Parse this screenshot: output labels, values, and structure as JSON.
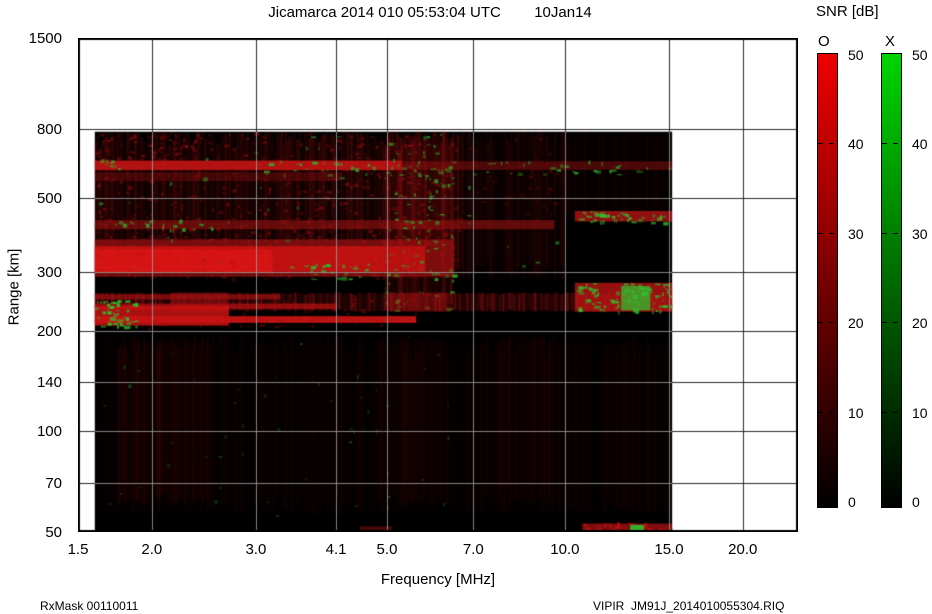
{
  "header": {
    "title": "Jicamarca 2014 010 05:53:04 UTC        10Jan14"
  },
  "footer": {
    "rx_mask": "RxMask 00110011",
    "file_info": "VIPIR  JM91J_2014010055304.RIQ"
  },
  "colorbar": {
    "title": "SNR [dB]",
    "min": 0,
    "max": 50,
    "bars": [
      {
        "label": "O",
        "top_color": "#ee0000",
        "bottom_color": "#000000",
        "ticks": [
          50,
          40,
          30,
          20,
          10,
          0
        ]
      },
      {
        "label": "X",
        "top_color": "#00d400",
        "bottom_color": "#000000",
        "ticks": [
          50,
          40,
          30,
          20,
          10,
          0
        ]
      }
    ]
  },
  "chart_data": {
    "type": "heatmap",
    "title": "Jicamarca 2014 010 05:53:04 UTC 10Jan14",
    "xlabel": "Frequency [MHz]",
    "ylabel": "Range [km]",
    "x_scale": "log",
    "y_scale": "log",
    "xlim": [
      1.5,
      24.8
    ],
    "ylim": [
      50,
      1500
    ],
    "x_ticks": [
      1.5,
      2.0,
      3.0,
      4.1,
      5.0,
      7.0,
      10.0,
      15.0,
      20.0
    ],
    "x_tick_labels": [
      "1.5",
      "2.0",
      "3.0",
      "4.1",
      "5.0",
      "7.0",
      "10.0",
      "15.0",
      "20.0"
    ],
    "y_ticks": [
      50,
      70,
      100,
      140,
      200,
      300,
      500,
      800,
      1500
    ],
    "y_tick_labels": [
      "50",
      "70",
      "100",
      "140",
      "200",
      "300",
      "500",
      "800",
      "1500"
    ],
    "grid": true,
    "snr_range": [
      0,
      50
    ],
    "data_extent": {
      "f": [
        1.6,
        15.2
      ],
      "r": [
        50,
        788
      ]
    },
    "background_color": "#000000",
    "grid_color_over_data": "#9a9a9a",
    "grid_color_outside": "#2a2a2a",
    "features": [
      {
        "name": "data-background",
        "type": "band",
        "f": [
          1.6,
          15.2
        ],
        "r": [
          50,
          788
        ],
        "color": "#000000",
        "alpha": 1
      },
      {
        "name": "upper-noise-left",
        "type": "columns",
        "f": [
          1.6,
          6.6
        ],
        "r": [
          285,
          788
        ],
        "color": "#8a0f0f",
        "alpha": 0.42,
        "seed": 2
      },
      {
        "name": "upper-speckle-left",
        "type": "speckle",
        "f": [
          1.6,
          6.6
        ],
        "r": [
          285,
          788
        ],
        "color": "#a51212",
        "alpha": 0.5,
        "density": 1.0,
        "size": 4,
        "seed": 3
      },
      {
        "name": "upper-noise-mid",
        "type": "columns",
        "f": [
          6.6,
          9.9
        ],
        "r": [
          285,
          788
        ],
        "color": "#7a0d0d",
        "alpha": 0.28,
        "seed": 4
      },
      {
        "name": "upper-speckle-mid",
        "type": "speckle",
        "f": [
          6.6,
          9.9
        ],
        "r": [
          430,
          788
        ],
        "color": "#8a0f0f",
        "alpha": 0.38,
        "density": 0.6,
        "size": 4,
        "seed": 5
      },
      {
        "name": "upper-noise-right",
        "type": "columns",
        "f": [
          9.9,
          15.2
        ],
        "r": [
          430,
          788
        ],
        "color": "#5c0a0a",
        "alpha": 0.2,
        "seed": 6
      },
      {
        "name": "topleft-patch",
        "type": "speckle",
        "f": [
          1.6,
          2.4
        ],
        "r": [
          640,
          780
        ],
        "color": "#b41414",
        "alpha": 0.5,
        "density": 1.8,
        "size": 4,
        "seed": 7
      },
      {
        "name": "echo-620km-bright",
        "type": "band",
        "f": [
          1.6,
          5.3
        ],
        "r": [
          604,
          645
        ],
        "color": "#c81414",
        "alpha": 0.88
      },
      {
        "name": "echo-620km-faint",
        "type": "band",
        "f": [
          5.3,
          15.2
        ],
        "r": [
          605,
          642
        ],
        "color": "#8f1010",
        "alpha": 0.5
      },
      {
        "name": "echo-620km-green-dashes",
        "type": "speckle",
        "f": [
          3.0,
          15.15
        ],
        "r": [
          585,
          645
        ],
        "color": "#2eb32e",
        "alpha": 0.9,
        "density": 1.1,
        "size": 5,
        "seed": 8
      },
      {
        "name": "echo-620km-green-left",
        "type": "speckle",
        "f": [
          1.6,
          1.8
        ],
        "r": [
          598,
          652
        ],
        "color": "#2eb32e",
        "alpha": 0.9,
        "density": 2.5,
        "size": 4,
        "seed": 25
      },
      {
        "name": "echo-575km-faint",
        "type": "band",
        "f": [
          1.6,
          4.2
        ],
        "r": [
          560,
          595
        ],
        "color": "#7c0d0d",
        "alpha": 0.45
      },
      {
        "name": "echo-415km",
        "type": "band",
        "f": [
          1.6,
          9.6
        ],
        "r": [
          402,
          428
        ],
        "color": "#8f1111",
        "alpha": 0.65
      },
      {
        "name": "echo-415km-green",
        "type": "speckle",
        "f": [
          1.63,
          2.7
        ],
        "r": [
          400,
          432
        ],
        "color": "#2eb32e",
        "alpha": 0.85,
        "density": 1.6,
        "size": 4,
        "seed": 9
      },
      {
        "name": "echo-440km-right",
        "type": "band",
        "f": [
          10.4,
          15.2
        ],
        "r": [
          424,
          456
        ],
        "color": "#b41414",
        "alpha": 0.8
      },
      {
        "name": "echo-440km-right-green",
        "type": "speckle",
        "f": [
          10.5,
          15.15
        ],
        "r": [
          422,
          458
        ],
        "color": "#32c232",
        "alpha": 0.95,
        "density": 3.5,
        "size": 5,
        "seed": 10
      },
      {
        "name": "f-region-band",
        "type": "band",
        "f": [
          1.6,
          6.5
        ],
        "r": [
          290,
          375
        ],
        "color": "#951111",
        "alpha": 0.75
      },
      {
        "name": "f-region-core",
        "type": "band",
        "f": [
          1.6,
          5.8
        ],
        "r": [
          300,
          358
        ],
        "color": "#cc1313",
        "alpha": 0.85
      },
      {
        "name": "f-region-bright-left",
        "type": "band",
        "f": [
          1.6,
          3.2
        ],
        "r": [
          298,
          350
        ],
        "color": "#e01515",
        "alpha": 0.7
      },
      {
        "name": "f-region-speckle",
        "type": "speckle",
        "f": [
          1.6,
          6.5
        ],
        "r": [
          290,
          430
        ],
        "color": "#b41212",
        "alpha": 0.45,
        "density": 1.3,
        "size": 4,
        "seed": 11
      },
      {
        "name": "f-region-green-edge",
        "type": "speckle",
        "f": [
          3.4,
          6.5
        ],
        "r": [
          286,
          318
        ],
        "color": "#2eb32e",
        "alpha": 0.9,
        "density": 1.5,
        "size": 5,
        "seed": 12
      },
      {
        "name": "interference-5-6MHz",
        "type": "columns",
        "f": [
          4.95,
          6.45
        ],
        "r": [
          230,
          788
        ],
        "color": "#a51212",
        "alpha": 0.45,
        "seed": 13
      },
      {
        "name": "interference-5-6MHz-green",
        "type": "speckle",
        "f": [
          4.95,
          6.45
        ],
        "r": [
          230,
          788
        ],
        "color": "#2eb32e",
        "alpha": 0.8,
        "density": 0.8,
        "size": 4,
        "seed": 14
      },
      {
        "name": "scattered-green",
        "type": "speckle",
        "f": [
          1.6,
          9.8
        ],
        "r": [
          300,
          780
        ],
        "color": "#2a9a2a",
        "alpha": 0.7,
        "density": 0.05,
        "size": 4,
        "seed": 26
      },
      {
        "name": "midband-245km",
        "type": "columns",
        "f": [
          1.6,
          15.2
        ],
        "r": [
          228,
          260
        ],
        "color": "#941111",
        "alpha": 0.7,
        "seed": 15
      },
      {
        "name": "midband-seg-2MHz",
        "type": "band",
        "f": [
          2.15,
          2.7
        ],
        "r": [
          228,
          260
        ],
        "color": "#a81212",
        "alpha": 0.5
      },
      {
        "name": "midband-seg-5MHz",
        "type": "band",
        "f": [
          5.0,
          6.3
        ],
        "r": [
          228,
          260
        ],
        "color": "#a81212",
        "alpha": 0.45
      },
      {
        "name": "midband-bright-right",
        "type": "band",
        "f": [
          10.4,
          15.2
        ],
        "r": [
          228,
          278
        ],
        "color": "#bc1414",
        "alpha": 0.8
      },
      {
        "name": "midband-right-green-speckle",
        "type": "speckle",
        "f": [
          10.45,
          15.15
        ],
        "r": [
          228,
          278
        ],
        "color": "#2fc02f",
        "alpha": 0.95,
        "density": 3.0,
        "size": 5,
        "seed": 16
      },
      {
        "name": "midband-green-blob",
        "type": "band",
        "f": [
          12.45,
          13.95
        ],
        "r": [
          230,
          272
        ],
        "color": "#2fc02f",
        "alpha": 0.75
      },
      {
        "name": "streak-252km",
        "type": "band",
        "f": [
          1.6,
          3.3
        ],
        "r": [
          248,
          257
        ],
        "color": "#a01111",
        "alpha": 0.7
      },
      {
        "name": "streak-236km",
        "type": "band",
        "f": [
          1.6,
          4.1
        ],
        "r": [
          232,
          241
        ],
        "color": "#b41212",
        "alpha": 0.75
      },
      {
        "name": "streak-215km-bright",
        "type": "band",
        "f": [
          1.6,
          5.6
        ],
        "r": [
          211,
          221
        ],
        "color": "#d01414",
        "alpha": 0.9
      },
      {
        "name": "blob-210km-left",
        "type": "band",
        "f": [
          1.6,
          2.7
        ],
        "r": [
          207,
          237
        ],
        "color": "#c81313",
        "alpha": 0.85
      },
      {
        "name": "blob-green-left-edge",
        "type": "speckle",
        "f": [
          1.6,
          1.88
        ],
        "r": [
          205,
          248
        ],
        "color": "#2fc02f",
        "alpha": 0.95,
        "density": 4.5,
        "size": 5,
        "seed": 17
      },
      {
        "name": "blob-speckle",
        "type": "speckle",
        "f": [
          1.88,
          5.6
        ],
        "r": [
          205,
          250
        ],
        "color": "#a01111",
        "alpha": 0.45,
        "density": 1.2,
        "size": 4,
        "seed": 18
      },
      {
        "name": "valley-noise",
        "type": "columns",
        "f": [
          1.6,
          15.2
        ],
        "r": [
          56,
          193
        ],
        "color": "#6e0c0c",
        "alpha": 0.15,
        "seed": 19
      },
      {
        "name": "valley-noise-2MHz",
        "type": "columns",
        "f": [
          1.75,
          2.5
        ],
        "r": [
          60,
          193
        ],
        "color": "#7a0d0d",
        "alpha": 0.22,
        "seed": 20
      },
      {
        "name": "valley-noise-5MHz",
        "type": "columns",
        "f": [
          4.8,
          6.2
        ],
        "r": [
          60,
          193
        ],
        "color": "#6e0c0c",
        "alpha": 0.18,
        "seed": 21
      },
      {
        "name": "valley-noise-8MHz",
        "type": "columns",
        "f": [
          7.5,
          9.6
        ],
        "r": [
          60,
          193
        ],
        "color": "#6e0c0c",
        "alpha": 0.16,
        "seed": 22
      },
      {
        "name": "valley-green-specks",
        "type": "speckle",
        "f": [
          1.6,
          6.5
        ],
        "r": [
          56,
          193
        ],
        "color": "#1f7a1f",
        "alpha": 0.5,
        "density": 0.08,
        "size": 3,
        "seed": 23
      },
      {
        "name": "bottom-right-red-line",
        "type": "band",
        "f": [
          10.7,
          15.2
        ],
        "r": [
          50,
          53
        ],
        "color": "#a81212",
        "alpha": 0.75
      },
      {
        "name": "bottom-right-red-speckle",
        "type": "speckle",
        "f": [
          10.7,
          15.2
        ],
        "r": [
          50,
          53.5
        ],
        "color": "#c01414",
        "alpha": 0.9,
        "density": 5.0,
        "size": 4,
        "seed": 24
      },
      {
        "name": "bottom-right-green-dash",
        "type": "band",
        "f": [
          12.9,
          13.6
        ],
        "r": [
          50,
          52.5
        ],
        "color": "#2fc02f",
        "alpha": 0.9
      },
      {
        "name": "bottom-5MHz-mark",
        "type": "band",
        "f": [
          4.5,
          5.1
        ],
        "r": [
          50,
          52
        ],
        "color": "#8f1010",
        "alpha": 0.5
      }
    ]
  }
}
